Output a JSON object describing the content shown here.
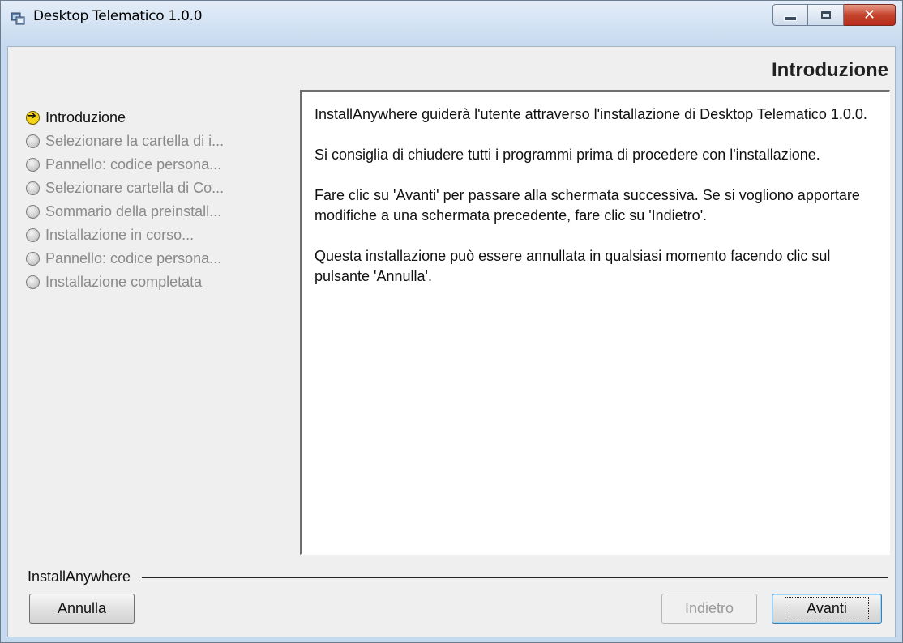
{
  "window": {
    "title": "Desktop Telematico 1.0.0",
    "controls": {
      "minimize_icon": "minimize-icon",
      "maximize_icon": "maximize-icon",
      "close_symbol": "✕"
    }
  },
  "header": {
    "title": "Introduzione"
  },
  "steps": [
    {
      "label": "Introduzione",
      "state": "current"
    },
    {
      "label": "Selezionare la cartella di i...",
      "state": "pending"
    },
    {
      "label": "Pannello: codice persona...",
      "state": "pending"
    },
    {
      "label": "Selezionare cartella di Co...",
      "state": "pending"
    },
    {
      "label": "Sommario della preinstall...",
      "state": "pending"
    },
    {
      "label": "Installazione in corso...",
      "state": "pending"
    },
    {
      "label": "Pannello: codice persona...",
      "state": "pending"
    },
    {
      "label": "Installazione completata",
      "state": "pending"
    }
  ],
  "content": {
    "paragraphs": [
      "InstallAnywhere guiderà l'utente attraverso l'installazione di Desktop Telematico 1.0.0.",
      "Si consiglia di chiudere tutti i programmi prima di procedere con l'installazione.",
      "Fare clic su 'Avanti' per passare alla schermata successiva. Se si vogliono apportare modifiche a una schermata precedente, fare clic su 'Indietro'.",
      "Questa installazione può essere annullata in qualsiasi momento facendo clic sul pulsante 'Annulla'."
    ]
  },
  "footer": {
    "brand": "InstallAnywhere",
    "cancel_label": "Annulla",
    "back_label": "Indietro",
    "back_enabled": false,
    "next_label": "Avanti"
  }
}
